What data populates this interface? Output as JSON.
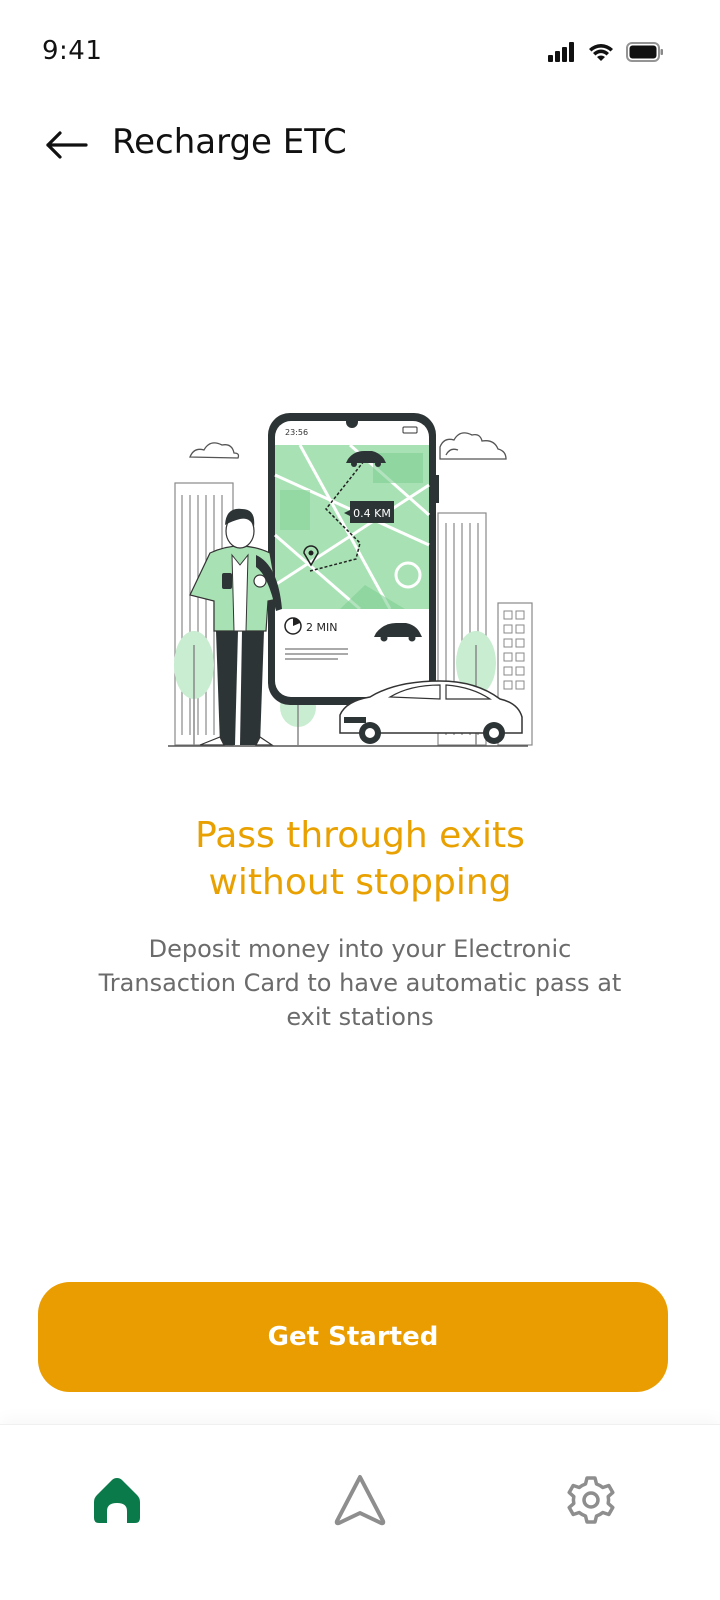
{
  "status_bar": {
    "time": "9:41",
    "icons": [
      "cellular-signal-icon",
      "wifi-icon",
      "battery-icon"
    ]
  },
  "header": {
    "back_icon": "arrow-left-icon",
    "title": "Recharge ETC"
  },
  "illustration": {
    "phone_time": "23:56",
    "distance_label": "0.4 KM",
    "eta_label": "2 MIN"
  },
  "content": {
    "headline_line1": "Pass through exits",
    "headline_line2": "without stopping",
    "description": "Deposit money into your Electronic Transaction Card to have automatic pass at exit stations"
  },
  "cta": {
    "label": "Get Started"
  },
  "bottom_nav": {
    "items": [
      {
        "icon": "home-icon",
        "active": true
      },
      {
        "icon": "navigation-arrow-icon",
        "active": false
      },
      {
        "icon": "gear-icon",
        "active": false
      }
    ]
  },
  "colors": {
    "accent": "#EA9D00",
    "headline": "#E8A100",
    "nav_active": "#0B7A4B",
    "nav_inactive": "#8e8e8e",
    "illustration_green": "#A8E2B4"
  }
}
